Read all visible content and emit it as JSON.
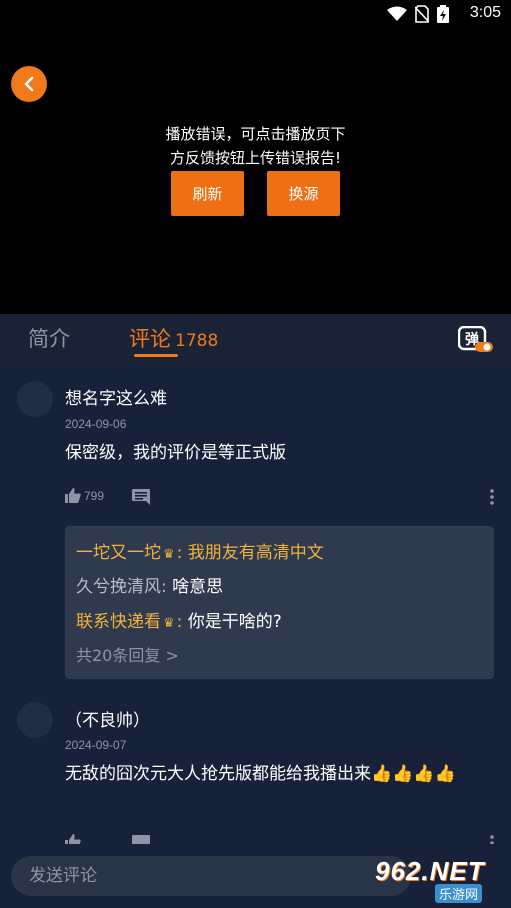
{
  "status_bar": {
    "time": "3:05"
  },
  "player": {
    "error_line1": "播放错误，可点击播放页下",
    "error_line2": "方反馈按钮上传错误报告!",
    "refresh_label": "刷新",
    "switch_source_label": "换源"
  },
  "tabs": {
    "intro_label": "简介",
    "comments_label": "评论",
    "comments_count": "1788",
    "danmu_label": "弹"
  },
  "comments": [
    {
      "name": "想名字这么难",
      "date": "2024-09-06",
      "text": "保密级，我的评价是等正式版",
      "likes": "799",
      "replies": [
        {
          "user": "一坨又一坨",
          "vip": true,
          "text": "我朋友有高清中文"
        },
        {
          "user": "久兮挽清风",
          "vip": false,
          "text": "啥意思"
        },
        {
          "user": "联系快递看",
          "vip": true,
          "text": "你是干啥的?"
        }
      ],
      "more_replies": "共20条回复 >"
    },
    {
      "name": "（不良帅）",
      "date": "2024-09-07",
      "text": "无敌的囧次元大人抢先版都能给我播出来"
    }
  ],
  "bottom_bar": {
    "input_placeholder": "发送评论"
  },
  "watermark": {
    "main": "962.NET",
    "sub": "乐游网"
  },
  "colors": {
    "accent": "#f07a1a",
    "panel": "#17213a",
    "gold": "#f0b23a"
  }
}
